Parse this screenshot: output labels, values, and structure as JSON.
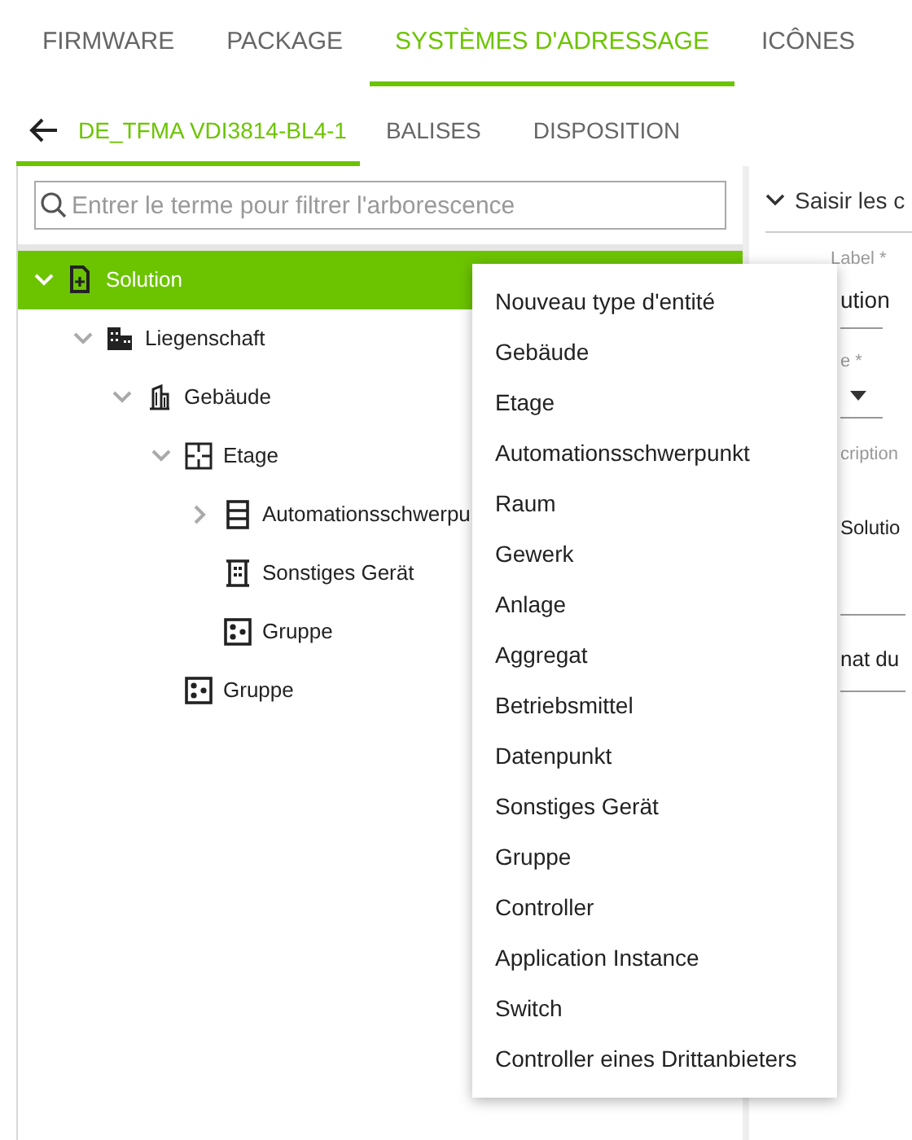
{
  "top_tabs": [
    {
      "label": "FIRMWARE",
      "selected": false
    },
    {
      "label": "PACKAGE",
      "selected": false
    },
    {
      "label": "SYSTÈMES D'ADRESSAGE",
      "selected": true
    },
    {
      "label": "ICÔNES",
      "selected": false
    }
  ],
  "sub_tabs": [
    {
      "label": "DE_TFMA VDI3814-BL4-1",
      "selected": true
    },
    {
      "label": "BALISES",
      "selected": false
    },
    {
      "label": "DISPOSITION",
      "selected": false
    }
  ],
  "filter": {
    "placeholder": "Entrer le terme pour filtrer l'arborescence"
  },
  "tree": [
    {
      "label": "Solution",
      "kind": "file",
      "expanded": true,
      "selected": true,
      "children": [
        {
          "label": "Liegenschaft",
          "kind": "site",
          "expanded": true,
          "selected": false,
          "children": [
            {
              "label": "Gebäude",
              "kind": "building",
              "expanded": true,
              "selected": false,
              "children": [
                {
                  "label": "Etage",
                  "kind": "floor",
                  "expanded": true,
                  "selected": false,
                  "children": [
                    {
                      "label": "Automationsschwerpu",
                      "kind": "cabinet",
                      "expanded": false,
                      "selected": false
                    },
                    {
                      "label": "Sonstiges Gerät",
                      "kind": "device",
                      "selected": false
                    },
                    {
                      "label": "Gruppe",
                      "kind": "group",
                      "selected": false
                    }
                  ]
                },
                {
                  "label": "Gruppe",
                  "kind": "group",
                  "selected": false
                }
              ]
            }
          ]
        }
      ]
    }
  ],
  "details": {
    "section": "Saisir les c",
    "label_caption": "Label *",
    "label_value": "ution",
    "type_caption": "e *",
    "description_caption": "cription",
    "description_value": "Solutio",
    "format_caption": "nat du"
  },
  "context_menu": [
    "Nouveau type d'entité",
    "Gebäude",
    "Etage",
    "Automationsschwerpunkt",
    "Raum",
    "Gewerk",
    "Anlage",
    "Aggregat",
    "Betriebsmittel",
    "Datenpunkt",
    "Sonstiges Gerät",
    "Gruppe",
    "Controller",
    "Application Instance",
    "Switch",
    "Controller eines Drittanbieters"
  ]
}
